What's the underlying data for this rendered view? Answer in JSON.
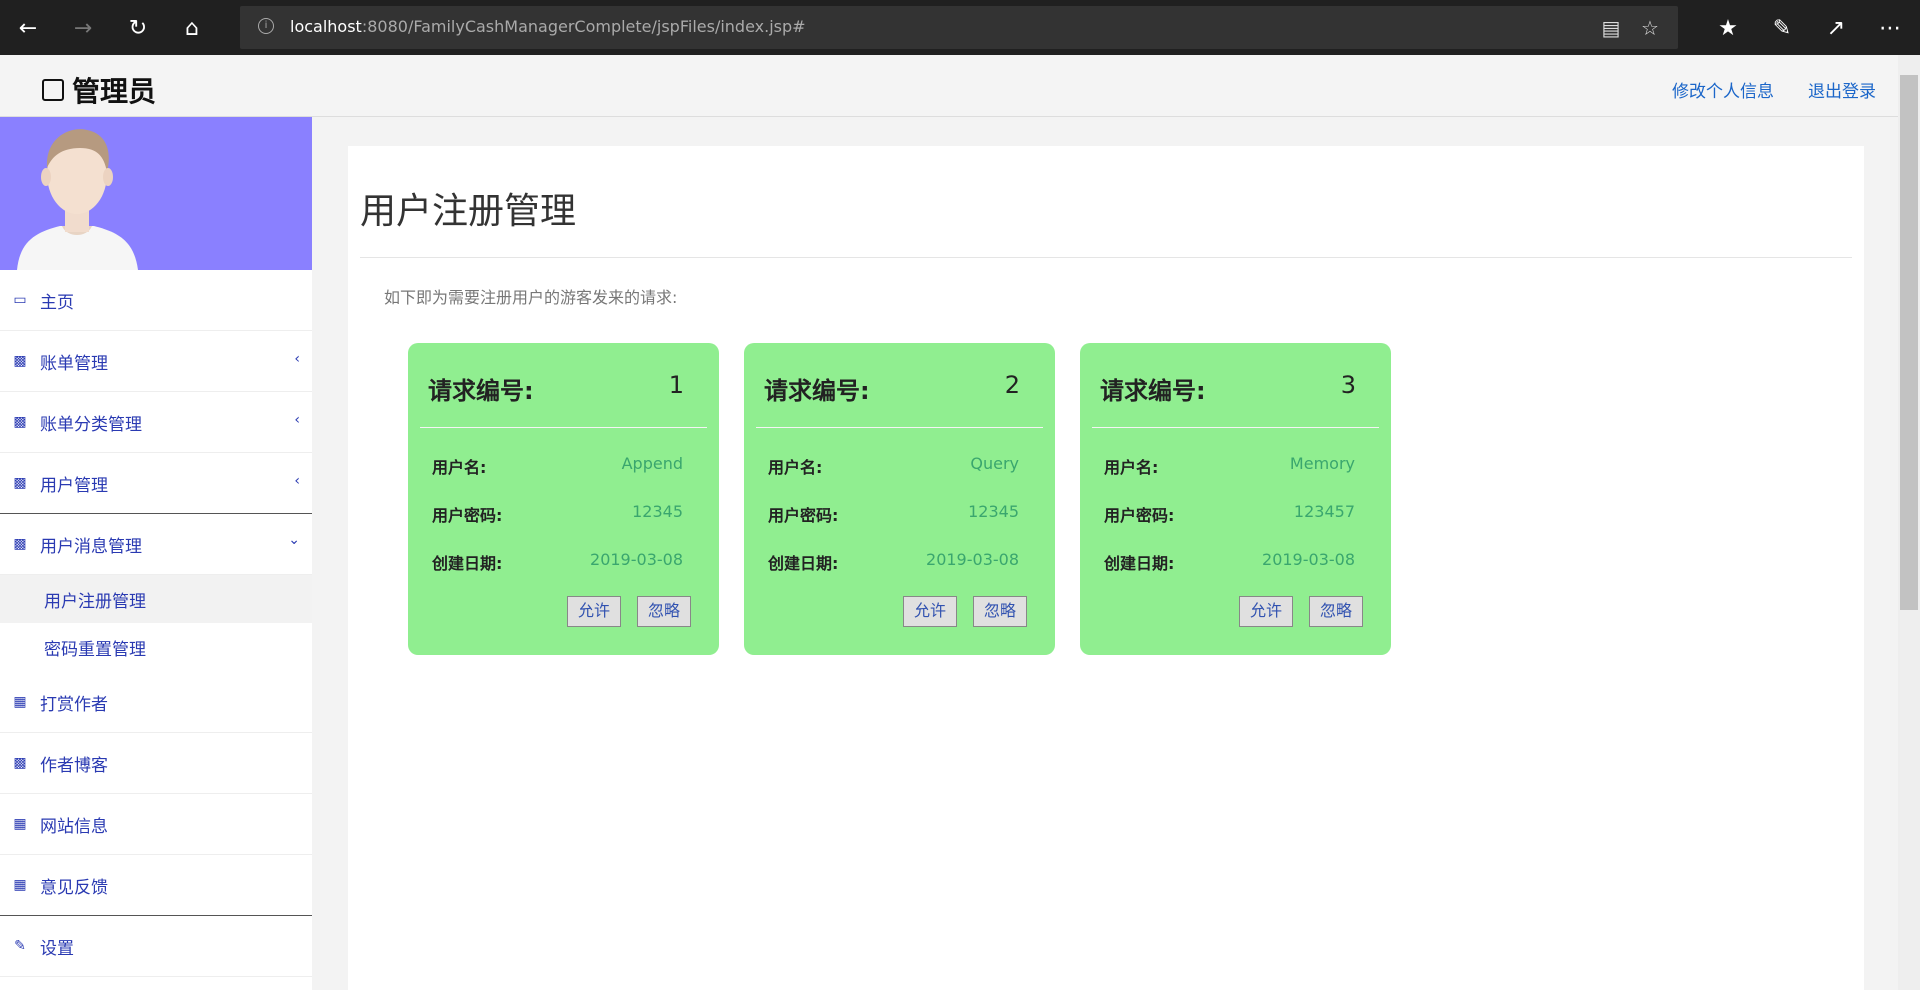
{
  "browser": {
    "url_host": "localhost",
    "url_rest": ":8080/FamilyCashManagerComplete/jspFiles/index.jsp#"
  },
  "header": {
    "brand": "管理员",
    "edit_profile": "修改个人信息",
    "logout": "退出登录"
  },
  "sidebar": {
    "items": [
      {
        "label": "主页",
        "icon": "monitor-icon"
      },
      {
        "label": "账单管理",
        "icon": "sitemap-icon"
      },
      {
        "label": "账单分类管理",
        "icon": "sitemap-icon"
      },
      {
        "label": "用户管理",
        "icon": "sitemap-icon"
      },
      {
        "label": "用户消息管理",
        "icon": "sitemap-icon"
      },
      {
        "label": "打赏作者",
        "icon": "qrcode-icon"
      },
      {
        "label": "作者博客",
        "icon": "bar-chart-icon"
      },
      {
        "label": "网站信息",
        "icon": "table-icon"
      },
      {
        "label": "意见反馈",
        "icon": "table-icon"
      },
      {
        "label": "设置",
        "icon": "edit-icon"
      }
    ],
    "subitems": [
      {
        "label": "用户注册管理"
      },
      {
        "label": "密码重置管理"
      }
    ]
  },
  "main": {
    "title": "用户注册管理",
    "description": "如下即为需要注册用户的游客发来的请求:",
    "field_labels": {
      "request_no": "请求编号:",
      "username": "用户名:",
      "password": "用户密码:",
      "created": "创建日期:"
    },
    "allow_label": "允许",
    "ignore_label": "忽略",
    "requests": [
      {
        "id": "1",
        "username": "Append",
        "password": "12345",
        "created": "2019-03-08"
      },
      {
        "id": "2",
        "username": "Query",
        "password": "12345",
        "created": "2019-03-08"
      },
      {
        "id": "3",
        "username": "Memory",
        "password": "123457",
        "created": "2019-03-08"
      }
    ]
  },
  "colors": {
    "card_bg": "#90ee90",
    "avatar_bg": "#8a80ff",
    "nav_text": "#2a3ab2",
    "link": "#1b66c9"
  }
}
